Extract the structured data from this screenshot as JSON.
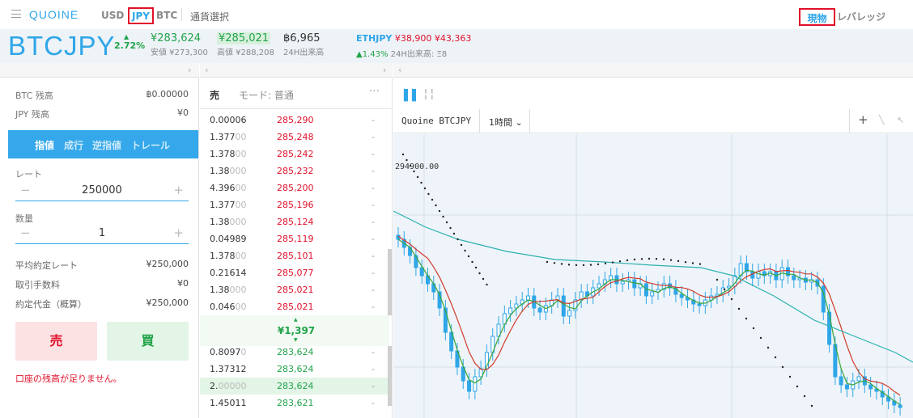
{
  "nav": {
    "logo": "QUOINE",
    "currencies": [
      "USD",
      "JPY",
      "BTC"
    ],
    "currency_select": "通貨選択",
    "mode_spot": "現物",
    "mode_leverage": "レバレッジ"
  },
  "ticker": {
    "pair": "BTCJPY",
    "change": "2.72%",
    "low_price": "¥283,624",
    "low_label": "安値 ¥273,300",
    "high_price": "¥285,021",
    "high_label": "高値 ¥288,208",
    "volume": "฿6,965",
    "volume_label": "24H出来高",
    "other": {
      "pair": "ETHJPY",
      "bid": "¥38,900",
      "ask": "¥43,363",
      "change": "▲1.43%",
      "volume_label": "24H出来高: Ξ8"
    }
  },
  "balance": {
    "btc_label": "BTC 残高",
    "btc_value": "฿0.00000",
    "jpy_label": "JPY 残高",
    "jpy_value": "¥0"
  },
  "order_tabs": [
    "指値",
    "成行",
    "逆指値",
    "トレール"
  ],
  "form": {
    "rate_label": "レート",
    "rate_value": "250000",
    "qty_label": "数量",
    "qty_value": "1",
    "avg_rate_label": "平均約定レート",
    "avg_rate_value": "¥250,000",
    "fee_label": "取引手数料",
    "fee_value": "¥0",
    "total_label": "約定代金（概算）",
    "total_value": "¥250,000",
    "sell_label": "売",
    "buy_label": "買",
    "warning": "口座の残高が足りません。"
  },
  "book": {
    "side_label": "売",
    "mode_label": "モード: 普通",
    "asks": [
      {
        "amt": "0.00006",
        "fade": "",
        "price": "285,290"
      },
      {
        "amt": "1.377",
        "fade": "00",
        "price": "285,248"
      },
      {
        "amt": "1.378",
        "fade": "00",
        "price": "285,242"
      },
      {
        "amt": "1.38",
        "fade": "000",
        "price": "285,232"
      },
      {
        "amt": "4.396",
        "fade": "00",
        "price": "285,200"
      },
      {
        "amt": "1.377",
        "fade": "00",
        "price": "285,196"
      },
      {
        "amt": "1.38",
        "fade": "000",
        "price": "285,124"
      },
      {
        "amt": "0.04989",
        "fade": "",
        "price": "285,119"
      },
      {
        "amt": "1.378",
        "fade": "00",
        "price": "285,101"
      },
      {
        "amt": "0.21614",
        "fade": "",
        "price": "285,077"
      },
      {
        "amt": "1.38",
        "fade": "000",
        "price": "285,021"
      },
      {
        "amt": "0.046",
        "fade": "00",
        "price": "285,021"
      }
    ],
    "spread": "¥1,397",
    "bids": [
      {
        "amt": "0.8097",
        "fade": "0",
        "price": "283,624"
      },
      {
        "amt": "1.37312",
        "fade": "",
        "price": "283,624"
      },
      {
        "amt": "2.",
        "fade": "00000",
        "price": "283,624"
      },
      {
        "amt": "1.45011",
        "fade": "",
        "price": "283,621"
      }
    ]
  },
  "chart_toolbar": {
    "symbol": "Quoine BTCJPY",
    "interval": "1時間"
  },
  "chart_data": {
    "type": "line",
    "price_label": "294900.00",
    "colors": {
      "up": "#2fa6e8",
      "ma_fast": "#39a537",
      "ma_mid": "#d13b2b",
      "ma_slow": "#2bb0b0",
      "sar": "#222222"
    }
  }
}
